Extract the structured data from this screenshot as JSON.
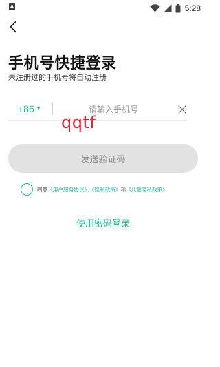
{
  "status_bar": {
    "app_indicator": "A",
    "time": "5:28",
    "icons": [
      "wifi-icon",
      "signal-icon",
      "battery-icon"
    ]
  },
  "header": {
    "back_icon": "chevron-left-icon"
  },
  "login": {
    "title": "手机号快捷登录",
    "subtitle": "未注册过的手机号将自动注册",
    "country_code": "+86",
    "phone_value": "",
    "phone_placeholder": "请输入手机号",
    "captcha_text": "qqtf",
    "send_code_label": "发送验证码",
    "agreement": {
      "prefix": "同意",
      "user_agreement": "《用户服务协议》",
      "separator": "、",
      "privacy_policy": "《隐私政策》",
      "conjunction": "和",
      "child_privacy": "《儿童隐私政策》"
    },
    "password_login_label": "使用密码登录"
  },
  "colors": {
    "accent": "#2bb5a0",
    "captcha": "#e0243a",
    "button_disabled_bg": "#e2e2e2",
    "button_disabled_text": "#8e8e8e"
  }
}
